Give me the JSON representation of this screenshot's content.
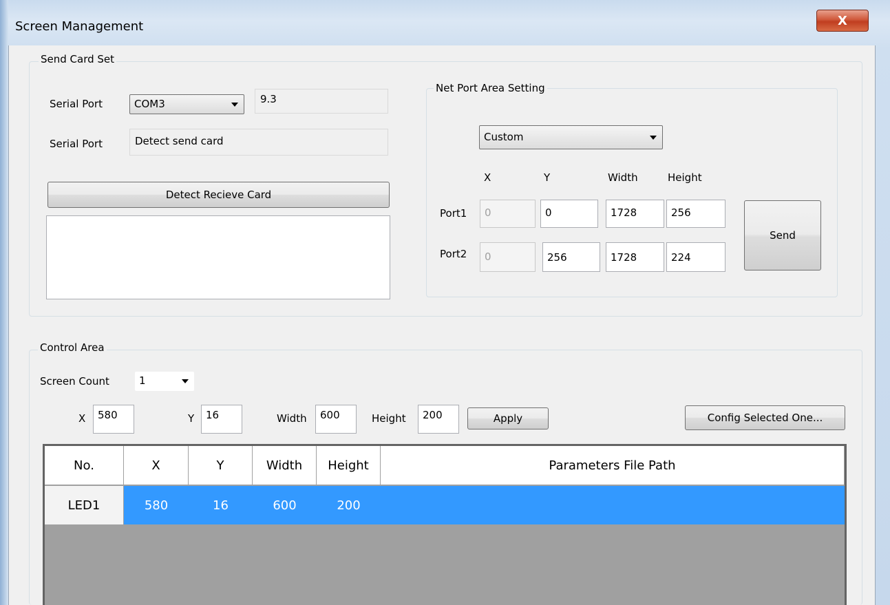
{
  "window": {
    "title": "Screen Management",
    "close_glyph": "X"
  },
  "send_card": {
    "group_label": "Send Card Set",
    "serial_port_label": "Serial Port",
    "serial_port_value": "COM3",
    "version": "9.3",
    "serial_port2_label": "Serial Port",
    "detect_status": "Detect send card",
    "detect_button": "Detect Recieve Card",
    "result_text": ""
  },
  "net_port": {
    "group_label": "Net Port Area Setting",
    "mode": "Custom",
    "headers": {
      "x": "X",
      "y": "Y",
      "width": "Width",
      "height": "Height"
    },
    "ports": [
      {
        "label": "Port1",
        "x": "0",
        "y": "0",
        "width": "1728",
        "height": "256"
      },
      {
        "label": "Port2",
        "x": "0",
        "y": "256",
        "width": "1728",
        "height": "224"
      }
    ],
    "send_button": "Send"
  },
  "control": {
    "group_label": "Control Area",
    "screen_count_label": "Screen Count",
    "screen_count": "1",
    "x_label": "X",
    "x": "580",
    "y_label": "Y",
    "y": "16",
    "width_label": "Width",
    "width": "600",
    "height_label": "Height",
    "height": "200",
    "apply_button": "Apply",
    "config_button": "Config Selected One..."
  },
  "table": {
    "columns": [
      "No.",
      "X",
      "Y",
      "Width",
      "Height",
      "Parameters File Path"
    ],
    "rows": [
      {
        "no": "LED1",
        "x": "580",
        "y": "16",
        "width": "600",
        "height": "200",
        "path": ""
      }
    ]
  },
  "colors": {
    "selection": "#3399ff",
    "empty_grid": "#a0a0a0",
    "close_button": "#c94a2c"
  },
  "icons": {
    "close": "close-icon",
    "dropdown": "chevron-down-icon"
  }
}
